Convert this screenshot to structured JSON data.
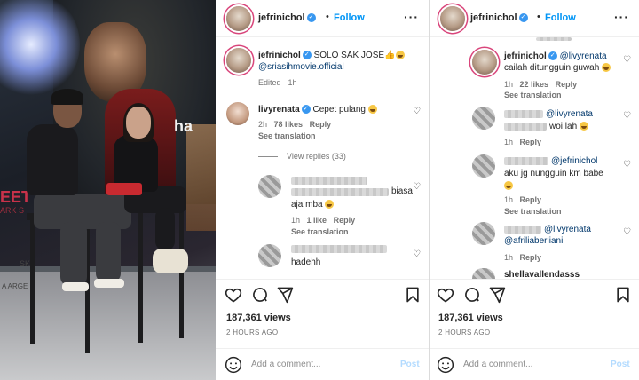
{
  "post_owner": "jefrinichol",
  "follow_label": "Follow",
  "caption": {
    "text": "SOLO SAK JOSE",
    "mention": "@sriasihmovie.official",
    "edited": "Edited · 1h"
  },
  "comments": [
    {
      "user": "livyrenata",
      "text": "Cepet pulang",
      "time": "2h",
      "likes": "78 likes",
      "reply": "Reply",
      "see_translation": "See translation",
      "view_replies": "View replies (33)",
      "replies": [
        {
          "text_tail": "biasa",
          "text_line2": "aja mba",
          "time": "1h",
          "likes": "1 like",
          "reply": "Reply",
          "see_translation": "See translation"
        },
        {
          "text": "hadehh"
        }
      ]
    }
  ],
  "right_replies": [
    {
      "user": "jefrinichol",
      "mention": "@livyrenata",
      "text": "cailah ditungguin guwah",
      "time": "1h",
      "likes": "22 likes",
      "reply": "Reply",
      "see_translation": "See translation"
    },
    {
      "mention": "@livyrenata",
      "text": "woi lah",
      "time": "1h",
      "reply": "Reply"
    },
    {
      "mention": "@jefrinichol",
      "text": "aku jg nungguin km babe",
      "time": "1h",
      "reply": "Reply",
      "see_translation": "See translation"
    },
    {
      "mention1": "@livyrenata",
      "mention2": "@afriliaberliani",
      "time": "1h",
      "reply": "Reply"
    }
  ],
  "right_partial_user": "shellavallendasss",
  "views": "187,361 views",
  "time_ago": "2 HOURS AGO",
  "add_comment_placeholder": "Add a comment...",
  "post_label": "Post",
  "photo_text": {
    "sign": "ha",
    "poster": "EET",
    "poster_sub": "ARK S",
    "stage": "SK",
    "stage2": "A ARGE"
  },
  "colors": {
    "follow": "#0095f6",
    "mention": "#00376b",
    "verified": "#3897f0",
    "post_disabled": "#b3dbff"
  }
}
